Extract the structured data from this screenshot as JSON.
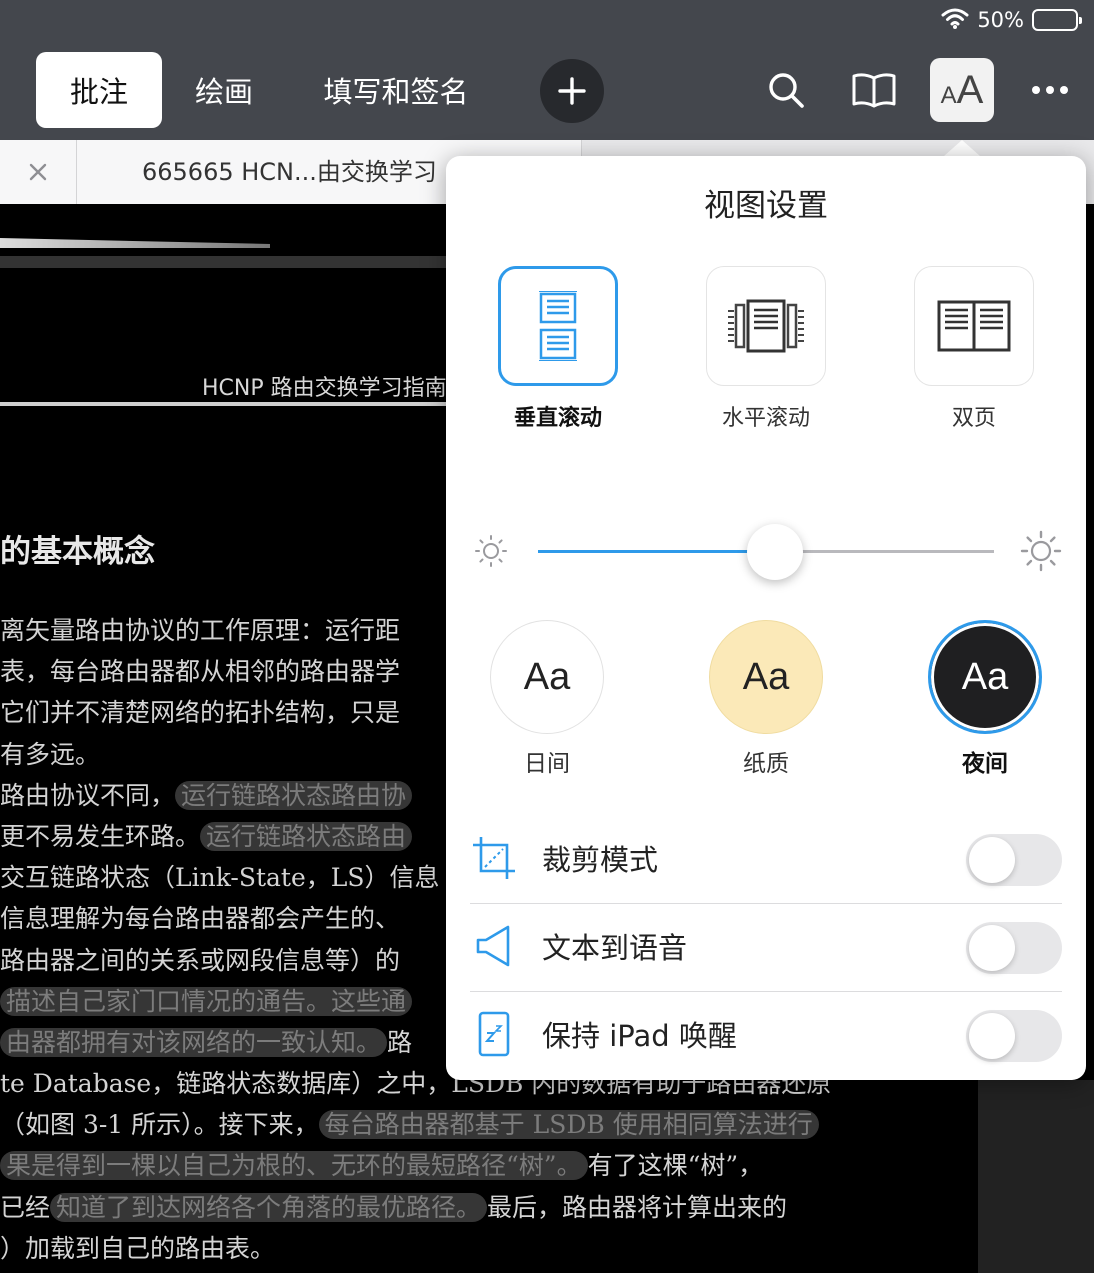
{
  "status": {
    "battery": "50%",
    "battery_level": 0.5
  },
  "toolbar": {
    "tabs": [
      {
        "label": "批注",
        "active": true
      },
      {
        "label": "绘画",
        "active": false
      },
      {
        "label": "填写和签名",
        "active": false
      }
    ],
    "icons": [
      "plus-icon",
      "search-icon",
      "book-icon",
      "text-size-icon",
      "more-icon"
    ],
    "text_size_label": "AA"
  },
  "doc_tab": {
    "title": "665665 HCN...由交换学习"
  },
  "document": {
    "running_head": "HCNP 路由交换学习指南",
    "heading": "的基本概念",
    "lines": [
      [
        {
          "t": "离矢量路由协议的工作原理：运行距"
        }
      ],
      [
        {
          "t": "表，每台路由器都从相邻的路由器学"
        }
      ],
      [
        {
          "t": "它们并不清楚网络的拓扑结构，只是"
        }
      ],
      [
        {
          "t": "有多远。"
        }
      ],
      [
        {
          "t": "路由协议不同，"
        },
        {
          "t": "运行链路状态路由协",
          "hl": true
        }
      ],
      [
        {
          "t": "更不易发生环路。"
        },
        {
          "t": "运行链路状态路由",
          "hl": true
        }
      ],
      [
        {
          "t": "交互链路状态（Link-State，LS）信息"
        }
      ],
      [
        {
          "t": "信息理解为每台路由器都会产生的、"
        }
      ],
      [
        {
          "t": "路由器之间的关系或网段信息等）的"
        }
      ],
      [
        {
          "t": "描述自己家门口情况的通告。这些通",
          "hl": true
        }
      ],
      [
        {
          "t": "由器都拥有对该网络的一致认知。",
          "hl": true
        },
        {
          "t": "路"
        }
      ],
      [
        {
          "t": "te Database，链路状态数据库）之中，LSDB 内的数据有助于路由器还原"
        }
      ],
      [
        {
          "t": "（如图 3-1 所示）。接下来，"
        },
        {
          "t": "每台路由器都基于 LSDB 使用相同算法进行",
          "hl": true
        }
      ],
      [
        {
          "t": "果是得到一棵以自己为根的、无环的最短路径“树”。",
          "hl": true
        },
        {
          "t": "有了这棵“树”，"
        }
      ],
      [
        {
          "t": "已经"
        },
        {
          "t": "知道了到达网络各个角落的最优路径。",
          "hl": true
        },
        {
          "t": "最后，路由器将计算出来的"
        }
      ],
      [
        {
          "t": "）加载到自己的路由表。"
        }
      ]
    ]
  },
  "popover": {
    "title": "视图设置",
    "modes": [
      {
        "label": "垂直滚动",
        "icon": "vertical-scroll-icon",
        "selected": true
      },
      {
        "label": "水平滚动",
        "icon": "horizontal-scroll-icon",
        "selected": false
      },
      {
        "label": "双页",
        "icon": "two-page-icon",
        "selected": false
      }
    ],
    "brightness": 0.52,
    "themes": [
      {
        "label": "日间",
        "sample": "Aa",
        "bg": "#ffffff",
        "fg": "#222222",
        "border": "#e2e2e2",
        "selected": false
      },
      {
        "label": "纸质",
        "sample": "Aa",
        "bg": "#fbe9b8",
        "fg": "#222222",
        "border": "#f0dca0",
        "selected": false
      },
      {
        "label": "夜间",
        "sample": "Aa",
        "bg": "#1f1f21",
        "fg": "#ffffff",
        "border": "#2e9aea",
        "selected": true
      }
    ],
    "toggles": [
      {
        "label": "裁剪模式",
        "icon": "crop-icon",
        "on": false
      },
      {
        "label": "文本到语音",
        "icon": "speaker-icon",
        "on": false
      },
      {
        "label": "保持 iPad 唤醒",
        "icon": "tablet-sleep-icon",
        "on": false
      }
    ]
  },
  "colors": {
    "accent": "#2e9aea",
    "toolbar": "#44474d",
    "highlight": "#787878"
  }
}
